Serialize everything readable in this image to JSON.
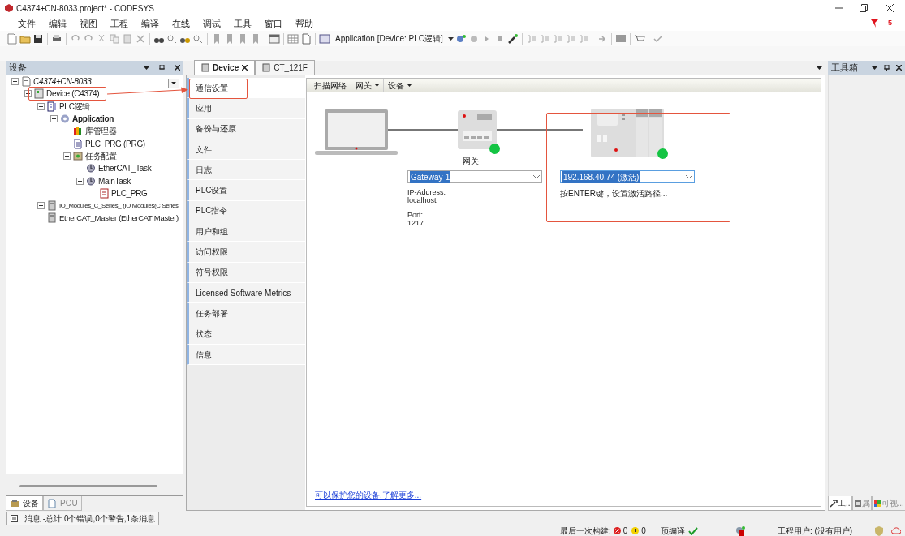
{
  "window": {
    "title": "C4374+CN-8033.project* - CODESYS"
  },
  "menu": [
    "文件",
    "编辑",
    "视图",
    "工程",
    "编译",
    "在线",
    "调试",
    "工具",
    "窗口",
    "帮助"
  ],
  "filter_badge": "5",
  "toolbar": {
    "app_selector": "Application [Device: PLC逻辑]"
  },
  "devices_panel": {
    "title": "设备",
    "tree": [
      {
        "label": "C4374+CN-8033",
        "kind": "project",
        "expanded": true,
        "children": [
          {
            "label": "Device (C4374)",
            "kind": "device",
            "expanded": true,
            "children": [
              {
                "label": "PLC逻辑",
                "kind": "logic",
                "expanded": true,
                "children": [
                  {
                    "label": "Application",
                    "kind": "application",
                    "active": true,
                    "expanded": true,
                    "children": [
                      {
                        "label": "库管理器",
                        "kind": "library"
                      },
                      {
                        "label": "PLC_PRG (PRG)",
                        "kind": "pou"
                      },
                      {
                        "label": "任务配置",
                        "kind": "taskconfig",
                        "expanded": true,
                        "children": [
                          {
                            "label": "EtherCAT_Task",
                            "kind": "task"
                          },
                          {
                            "label": "MainTask",
                            "kind": "task",
                            "expanded": true,
                            "children": [
                              {
                                "label": "PLC_PRG",
                                "kind": "call"
                              }
                            ]
                          }
                        ]
                      }
                    ]
                  }
                ]
              },
              {
                "label": "IO_Modules_C_Series_ (IO Modules(C Series",
                "kind": "module",
                "expanded": false
              },
              {
                "label": "EtherCAT_Master (EtherCAT Master)",
                "kind": "module"
              }
            ]
          }
        ]
      }
    ],
    "tabs": [
      {
        "label": "设备",
        "selected": true
      },
      {
        "label": "POU",
        "selected": false
      }
    ]
  },
  "editor": {
    "tabs": [
      {
        "label": "Device",
        "selected": true
      },
      {
        "label": "CT_121F",
        "selected": false
      }
    ],
    "nav": [
      {
        "label": "通信设置",
        "selected": true
      },
      {
        "label": "应用",
        "selected": false
      },
      {
        "label": "备份与还原",
        "selected": false
      },
      {
        "label": "文件",
        "selected": false
      },
      {
        "label": "日志",
        "selected": false
      },
      {
        "label": "PLC设置",
        "selected": false
      },
      {
        "label": "PLC指令",
        "selected": false
      },
      {
        "label": "用户和组",
        "selected": false
      },
      {
        "label": "访问权限",
        "selected": false
      },
      {
        "label": "符号权限",
        "selected": false
      },
      {
        "label": "Licensed Software Metrics",
        "selected": false
      },
      {
        "label": "任务部署",
        "selected": false
      },
      {
        "label": "状态",
        "selected": false
      },
      {
        "label": "信息",
        "selected": false
      }
    ],
    "commands": [
      {
        "label": "扫描网络",
        "dropdown": false
      },
      {
        "label": "网关",
        "dropdown": true
      },
      {
        "label": "设备",
        "dropdown": true
      }
    ],
    "gateway": {
      "label": "网关",
      "value": "Gateway-1",
      "connected": true,
      "info": [
        {
          "label": "IP-Address:",
          "value": "localhost"
        },
        {
          "label": "Port:",
          "value": "1217"
        }
      ]
    },
    "device": {
      "value": "192.168.40.74 (激活)",
      "connected": true,
      "hint": "按ENTER键，设置激活路径..."
    },
    "link": "可以保护您的设备,了解更多..."
  },
  "toolbox": {
    "title": "工具箱",
    "tabs": [
      {
        "label": "工..",
        "selected": true
      },
      {
        "label": "属",
        "selected": false
      },
      {
        "label": "可视...",
        "selected": false
      }
    ]
  },
  "messages": "消息 -总计 0个错误,0个警告,1条消息",
  "status_bar": {
    "build_label": "最后一次构建:",
    "errors": "0",
    "warnings": "0",
    "precompile": "预编译",
    "user": "工程用户: (没有用户)"
  }
}
